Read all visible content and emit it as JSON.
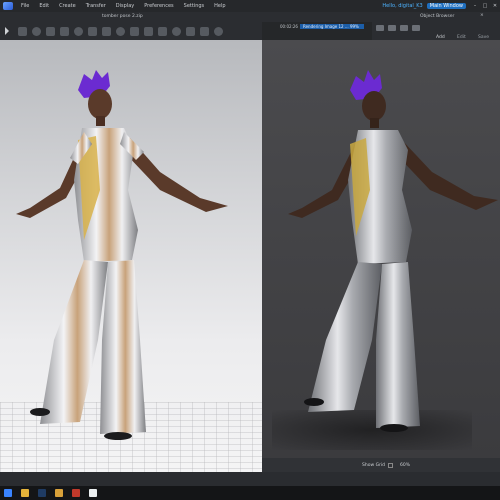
{
  "menubar": {
    "items": [
      "File",
      "Edit",
      "Create",
      "Transfer",
      "Display",
      "Preferences",
      "Settings",
      "Help"
    ],
    "user": "Hello, digital_K3",
    "badge": "Main Window",
    "window_controls": [
      "–",
      "□",
      "✕"
    ]
  },
  "document": {
    "title": "tomber pose 2.zip"
  },
  "right_panel": {
    "title": "Object Browser",
    "close_glyph": "×",
    "buttons": {
      "add": "Add",
      "edit": "Edit",
      "save": "Save"
    }
  },
  "render": {
    "time": "00:02:26",
    "progress_label": "Rendering Image 12 ... 99%",
    "progress_fraction": 0.99
  },
  "viewport_status": {
    "show_grid_label": "Show Grid",
    "zoom": "60%"
  },
  "taskbar": {
    "icons": [
      "windows-icon",
      "folder-icon",
      "photoshop-icon",
      "explorer-icon",
      "ds-icon",
      "c-icon"
    ]
  },
  "colors": {
    "accent": "#1c5ea8",
    "hair": "#6b2bd1",
    "skin": "#5a3a2a",
    "suit": "#d8d9dc"
  }
}
